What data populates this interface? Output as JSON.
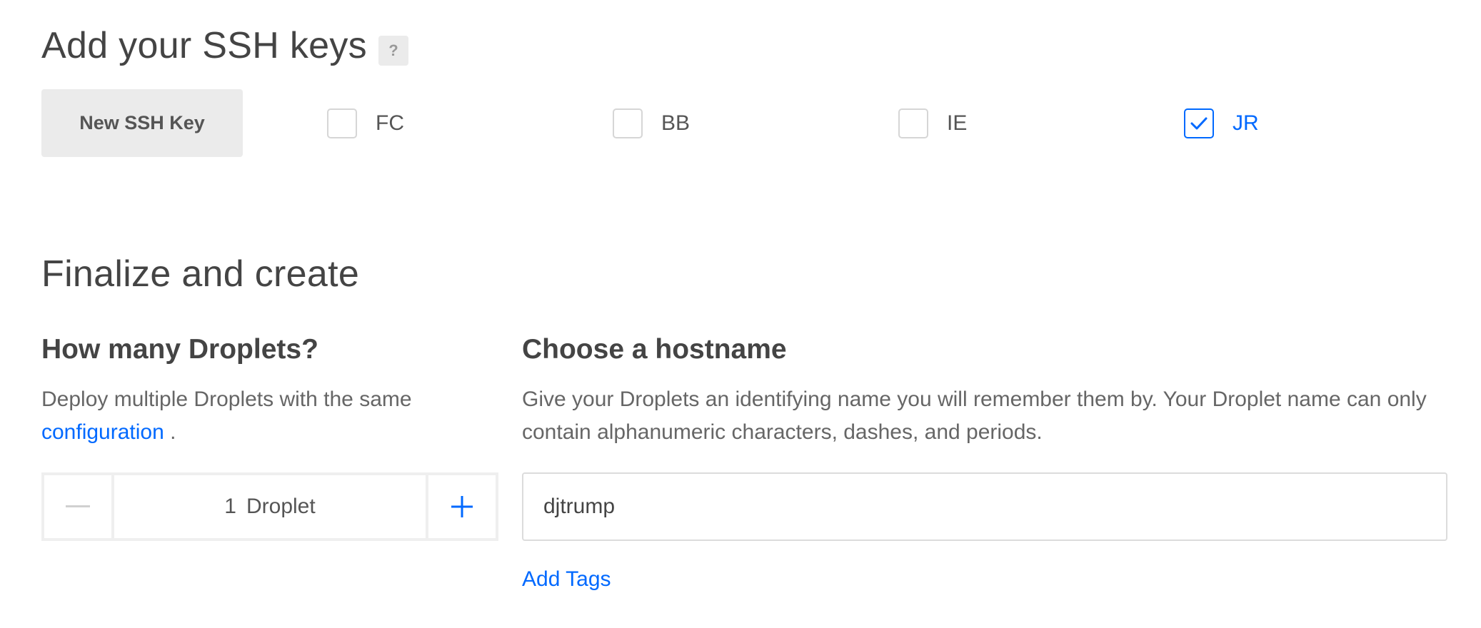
{
  "ssh_section": {
    "title": "Add your SSH keys",
    "help_label": "?",
    "new_key_button": "New SSH Key",
    "keys": [
      {
        "label": "FC",
        "checked": false
      },
      {
        "label": "BB",
        "checked": false
      },
      {
        "label": "IE",
        "checked": false
      },
      {
        "label": "JR",
        "checked": true
      }
    ]
  },
  "finalize": {
    "title": "Finalize and create"
  },
  "droplets": {
    "heading": "How many Droplets?",
    "description": "Deploy multiple Droplets with the same",
    "config_link": "configuration",
    "description_end": ".",
    "count": "1",
    "unit": "Droplet"
  },
  "hostname": {
    "heading": "Choose a hostname",
    "description": "Give your Droplets an identifying name you will remember them by. Your Droplet name can only contain alphanumeric characters, dashes, and periods.",
    "value": "djtrump",
    "add_tags": "Add Tags"
  },
  "colors": {
    "accent": "#0069ff",
    "text": "#444444",
    "muted": "#666666",
    "button_bg": "#ebebeb"
  }
}
